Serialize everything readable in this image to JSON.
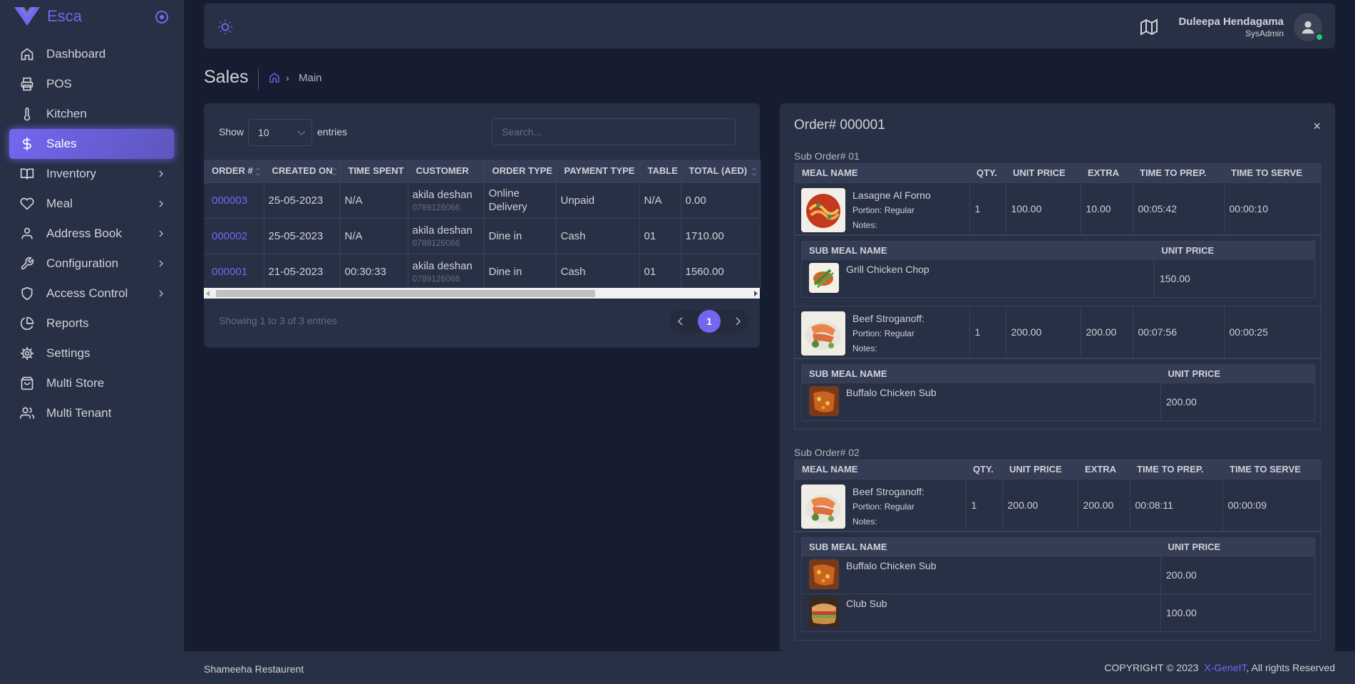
{
  "app": {
    "name": "Esca"
  },
  "sidebar": {
    "items": [
      {
        "label": "Dashboard",
        "icon": "home-icon"
      },
      {
        "label": "POS",
        "icon": "printer-icon"
      },
      {
        "label": "Kitchen",
        "icon": "thermometer-icon"
      },
      {
        "label": "Sales",
        "icon": "dollar-icon",
        "active": true
      },
      {
        "label": "Inventory",
        "icon": "book-icon",
        "has_children": true
      },
      {
        "label": "Meal",
        "icon": "heart-icon",
        "has_children": true
      },
      {
        "label": "Address Book",
        "icon": "user-icon",
        "has_children": true
      },
      {
        "label": "Configuration",
        "icon": "tool-icon",
        "has_children": true
      },
      {
        "label": "Access Control",
        "icon": "shield-icon",
        "has_children": true
      },
      {
        "label": "Reports",
        "icon": "pie-chart-icon"
      },
      {
        "label": "Settings",
        "icon": "gear-icon"
      },
      {
        "label": "Multi Store",
        "icon": "shopping-bag-icon"
      },
      {
        "label": "Multi Tenant",
        "icon": "users-icon"
      }
    ]
  },
  "header": {
    "user_name": "Duleepa Hendagama",
    "user_role": "SysAdmin",
    "status_color": "#28c76f"
  },
  "page": {
    "title": "Sales",
    "breadcrumb": "Main"
  },
  "sales_table": {
    "show_label": "Show",
    "entries_value": "10",
    "entries_label": "entries",
    "search_placeholder": "Search...",
    "columns": [
      "ORDER #",
      "CREATED ON",
      "TIME SPENT",
      "CUSTOMER",
      "ORDER TYPE",
      "PAYMENT TYPE",
      "TABLE",
      "TOTAL (AED)"
    ],
    "rows": [
      {
        "order": "000003",
        "created": "25-05-2023",
        "time_spent": "N/A",
        "customer": "akila deshan",
        "phone": "0789126066",
        "order_type": "Online Delivery",
        "payment": "Unpaid",
        "table": "N/A",
        "total": "0.00"
      },
      {
        "order": "000002",
        "created": "25-05-2023",
        "time_spent": "N/A",
        "customer": "akila deshan",
        "phone": "0789126066",
        "order_type": "Dine in",
        "payment": "Cash",
        "table": "01",
        "total": "1710.00"
      },
      {
        "order": "000001",
        "created": "21-05-2023",
        "time_spent": "00:30:33",
        "customer": "akila deshan",
        "phone": "0789126066",
        "order_type": "Dine in",
        "payment": "Cash",
        "table": "01",
        "total": "1560.00"
      }
    ],
    "showing_text": "Showing 1 to 3 of 3 entries",
    "current_page": "1"
  },
  "order_detail": {
    "title": "Order# 000001",
    "close": "×",
    "meal_columns": [
      "MEAL NAME",
      "QTY.",
      "UNIT PRICE",
      "EXTRA",
      "TIME TO PREP.",
      "TIME TO SERVE"
    ],
    "sub_columns": [
      "SUB MEAL NAME",
      "UNIT PRICE"
    ],
    "portion_text": "Portion: Regular",
    "notes_text": "Notes:",
    "sub_orders": [
      {
        "label": "Sub Order# 01",
        "meals": [
          {
            "name": "Lasagne Al Forno",
            "qty": "1",
            "unit_price": "100.00",
            "extra": "10.00",
            "prep": "00:05:42",
            "serve": "00:00:10",
            "subs": [
              {
                "name": "Grill Chicken Chop",
                "price": "150.00"
              }
            ]
          },
          {
            "name": "Beef Stroganoff:",
            "qty": "1",
            "unit_price": "200.00",
            "extra": "200.00",
            "prep": "00:07:56",
            "serve": "00:00:25",
            "subs": [
              {
                "name": "Buffalo Chicken Sub",
                "price": "200.00"
              }
            ]
          }
        ]
      },
      {
        "label": "Sub Order# 02",
        "meals": [
          {
            "name": "Beef Stroganoff:",
            "qty": "1",
            "unit_price": "200.00",
            "extra": "200.00",
            "prep": "00:08:11",
            "serve": "00:00:09",
            "subs": [
              {
                "name": "Buffalo Chicken Sub",
                "price": "200.00"
              },
              {
                "name": "Club Sub",
                "price": "100.00"
              }
            ]
          }
        ]
      }
    ]
  },
  "footer": {
    "restaurant": "Shameeha Restaurent",
    "copyright_prefix": "COPYRIGHT © 2023",
    "company": "X-GeneIT",
    "copyright_suffix": ", All rights Reserved"
  },
  "colors": {
    "accent": "#7367f0",
    "body_bg": "#161d31",
    "card_bg": "#283046"
  }
}
